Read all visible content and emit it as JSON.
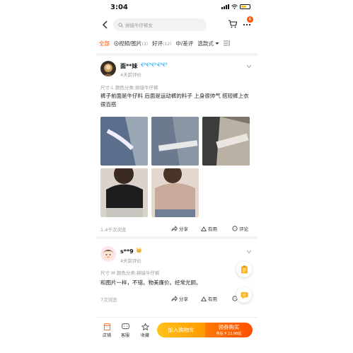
{
  "status": {
    "time": "3:04"
  },
  "search": {
    "placeholder": "拼接牛仔裤女"
  },
  "notification_count": "6",
  "tabs": [
    {
      "label": "全部",
      "count": ""
    },
    {
      "label": "视频/图片",
      "count": "(3)"
    },
    {
      "label": "好评",
      "count": "(12)"
    },
    {
      "label": "中/差评",
      "count": ""
    }
  ],
  "filter": {
    "label": "选款式"
  },
  "reviews": [
    {
      "username": "面**妹",
      "badge": "💎💎💎💎💎",
      "time": "4天前评价",
      "attrs": "尺寸:L 颜色分类:拼接牛仔裤",
      "text": "裤子前面是牛仔料 后面是运动裤的料子 上身很帅气 搭短裤上衣 很百搭",
      "views": "1.4千次浏览",
      "share": "分享",
      "useful": "有用",
      "comment": "评论"
    },
    {
      "username": "s**9",
      "badge": "👑",
      "time": "4天前评价",
      "attrs": "尺寸:M 颜色分类:拼接牛仔裤",
      "text": "和图片一样，不错。物美廉价。经常光顾。",
      "views": "7次浏览",
      "share": "分享",
      "useful": "有用",
      "comment": "评论"
    }
  ],
  "bottom": {
    "shop": "店铺",
    "service": "客服",
    "favorite": "收藏",
    "add_cart": "加入购物车",
    "buy": "领券购买",
    "buy_sub": "券后 ¥ 22.98起"
  },
  "colors": {
    "accent": "#ff5000",
    "gold": "#ffb31a"
  }
}
